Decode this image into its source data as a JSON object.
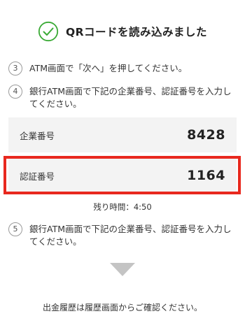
{
  "header": {
    "title": "QRコードを読み込みました",
    "check_color": "#3aaa35"
  },
  "steps": [
    {
      "number": "3",
      "text": "ATM画面で「次へ」を押してください。"
    },
    {
      "number": "4",
      "text": "銀行ATM画面で下記の企業番号、認証番号を入力してください。"
    },
    {
      "number": "5",
      "text": "銀行ATM画面で下記の企業番号、認証番号を入力してください。"
    }
  ],
  "company": {
    "label": "企業番号",
    "value": "8428"
  },
  "auth": {
    "label": "認証番号",
    "value": "1164"
  },
  "timer": {
    "text": "残り時間：4:50"
  },
  "footer": {
    "text": "出金履歴は履歴画面からご確認ください。"
  },
  "colors": {
    "highlight": "#e8281e",
    "row_background": "#f3f3f3",
    "arrow": "#c4c4c4"
  },
  "icons": {
    "header": "check-circle-icon",
    "next": "triangle-down-icon"
  }
}
